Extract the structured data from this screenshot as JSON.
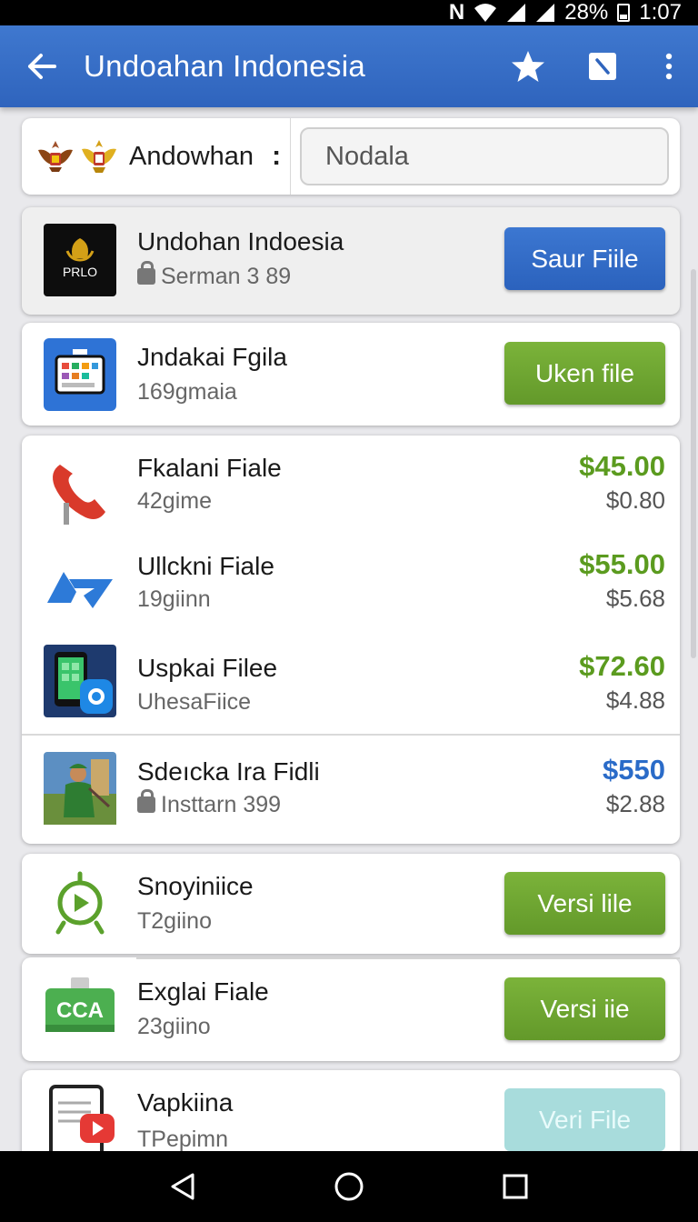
{
  "status_bar": {
    "network_letter": "N",
    "battery": "28%",
    "time": "1:07"
  },
  "app_bar": {
    "title": "Undoahan Indonesia"
  },
  "search_row": {
    "brand_label": "Andowhan",
    "brand_more": ":",
    "search_value": "Nodala"
  },
  "items": [
    {
      "title": "Undohan Indoesia",
      "subtitle": "Serman 3 89",
      "button": "Saur Fiile",
      "icon_text": "PRLO"
    },
    {
      "title": "Jndakai Fgila",
      "subtitle": "169gmaia",
      "button": "Uken file"
    },
    {
      "title": "Fkalani Fiale",
      "subtitle": "42gime",
      "price": "$45.00",
      "subprice": "$0.80"
    },
    {
      "title": "Ullckni Fiale",
      "subtitle": "19giinn",
      "price": "$55.00",
      "subprice": "$5.68"
    },
    {
      "title": "Uspkai Filee",
      "subtitle": "UhesaFiice",
      "price": "$72.60",
      "subprice": "$4.88"
    },
    {
      "title": "Sdeıcka Ira Fidli",
      "subtitle": "Insttarn 399",
      "price": "$550",
      "subprice": "$2.88"
    },
    {
      "title": "Snoyiniice",
      "subtitle": "T2giino",
      "button": "Versi lile"
    },
    {
      "title": "Exglai Fiale",
      "subtitle": "23giino",
      "button": "Versi iie",
      "icon_text": "CCA"
    },
    {
      "title": "Vapkiina",
      "subtitle": "TPepimn",
      "button": "Veri File"
    }
  ],
  "colors": {
    "app_bar": "#3670c6",
    "primary_button": "#2f67c2",
    "green_button": "#6fa732",
    "price_green": "#5b9b1f",
    "price_blue": "#2a6bc8",
    "disabled_button": "#a8dcdc"
  },
  "icons": {
    "back": "arrow-left-icon",
    "star": "star-icon",
    "edit": "edit-icon",
    "more": "more-vert-icon",
    "search": "search-icon",
    "nav_back": "triangle-back-icon",
    "nav_home": "circle-home-icon",
    "nav_recents": "square-recents-icon"
  }
}
